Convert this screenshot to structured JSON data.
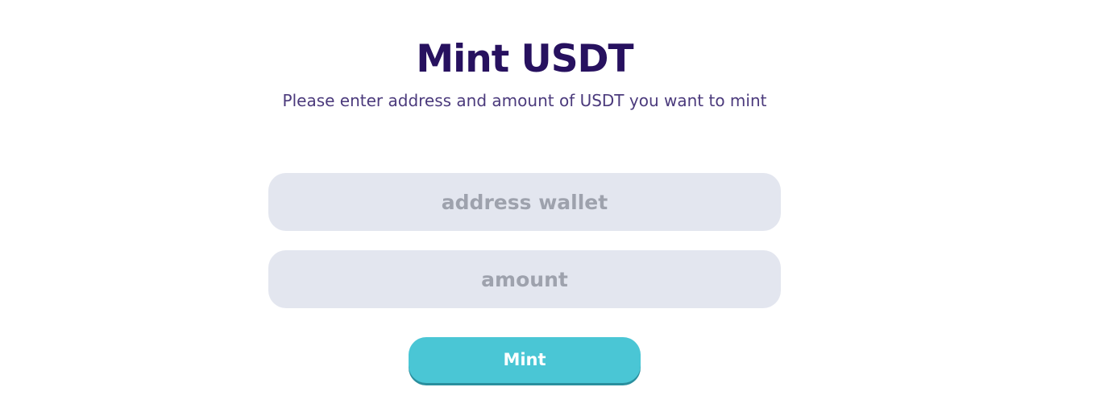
{
  "header": {
    "title": "Mint USDT",
    "subtitle": "Please enter address and amount of USDT you want to mint"
  },
  "form": {
    "address": {
      "value": "",
      "placeholder": "address wallet"
    },
    "amount": {
      "value": "",
      "placeholder": "amount"
    },
    "submit_label": "Mint"
  },
  "colors": {
    "title": "#27115f",
    "subtitle": "#4b3a7c",
    "field_background": "#e3e6ef",
    "placeholder": "#9ea2ad",
    "button": "#4ac6d5",
    "button_text": "#ffffff"
  }
}
